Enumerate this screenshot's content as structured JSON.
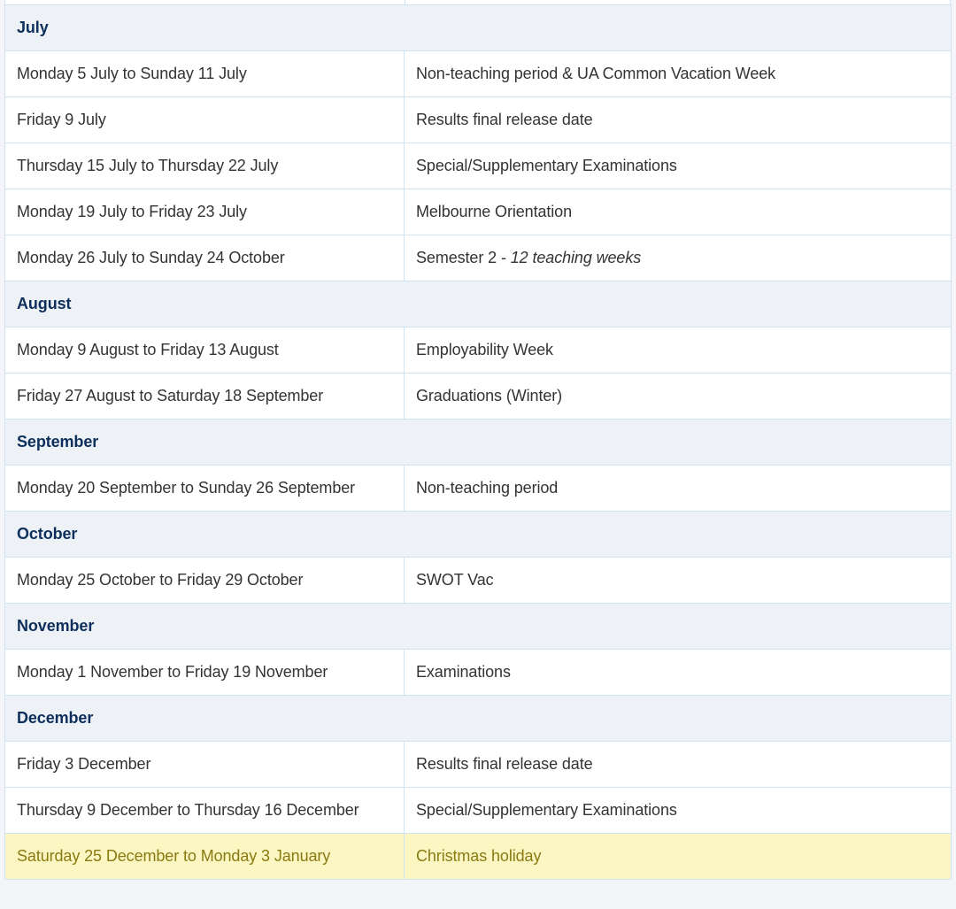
{
  "calendar": [
    {
      "type": "month",
      "label": "July"
    },
    {
      "type": "event",
      "date": "Monday 5 July to Sunday 11 July",
      "event": "Non-teaching period & UA Common Vacation Week"
    },
    {
      "type": "event",
      "date": "Friday 9 July",
      "event": "Results final release date"
    },
    {
      "type": "event",
      "date": "Thursday 15 July to Thursday 22 July",
      "event": "Special/Supplementary Examinations"
    },
    {
      "type": "event",
      "date": "Monday 19 July to Friday 23 July",
      "event": "Melbourne Orientation"
    },
    {
      "type": "event",
      "date": "Monday 26 July to Sunday 24 October",
      "event": "Semester 2 - ",
      "event_note": "12 teaching weeks"
    },
    {
      "type": "month",
      "label": "August"
    },
    {
      "type": "event",
      "date": "Monday 9 August to Friday 13 August",
      "event": "Employability Week"
    },
    {
      "type": "event",
      "date": "Friday 27 August to Saturday 18 September",
      "event": "Graduations (Winter)"
    },
    {
      "type": "month",
      "label": "September"
    },
    {
      "type": "event",
      "date": "Monday 20 September to Sunday 26 September",
      "event": "Non-teaching period"
    },
    {
      "type": "month",
      "label": "October"
    },
    {
      "type": "event",
      "date": "Monday 25 October to Friday 29 October",
      "event": "SWOT Vac"
    },
    {
      "type": "month",
      "label": "November"
    },
    {
      "type": "event",
      "date": "Monday 1 November to Friday 19 November",
      "event": "Examinations"
    },
    {
      "type": "month",
      "label": "December"
    },
    {
      "type": "event",
      "date": "Friday 3 December",
      "event": "Results final release date"
    },
    {
      "type": "event",
      "date": "Thursday 9 December to Thursday 16 December",
      "event": "Special/Supplementary Examinations"
    },
    {
      "type": "event",
      "date": "Saturday 25 December to Monday 3 January",
      "event": "Christmas holiday",
      "highlight": true
    }
  ],
  "colors": {
    "month_header_bg": "#eef2f6",
    "month_header_text": "#0d2f5c",
    "border": "#cfe3f2",
    "highlight_bg": "#fbf6c2",
    "highlight_text": "#8a7a12"
  }
}
